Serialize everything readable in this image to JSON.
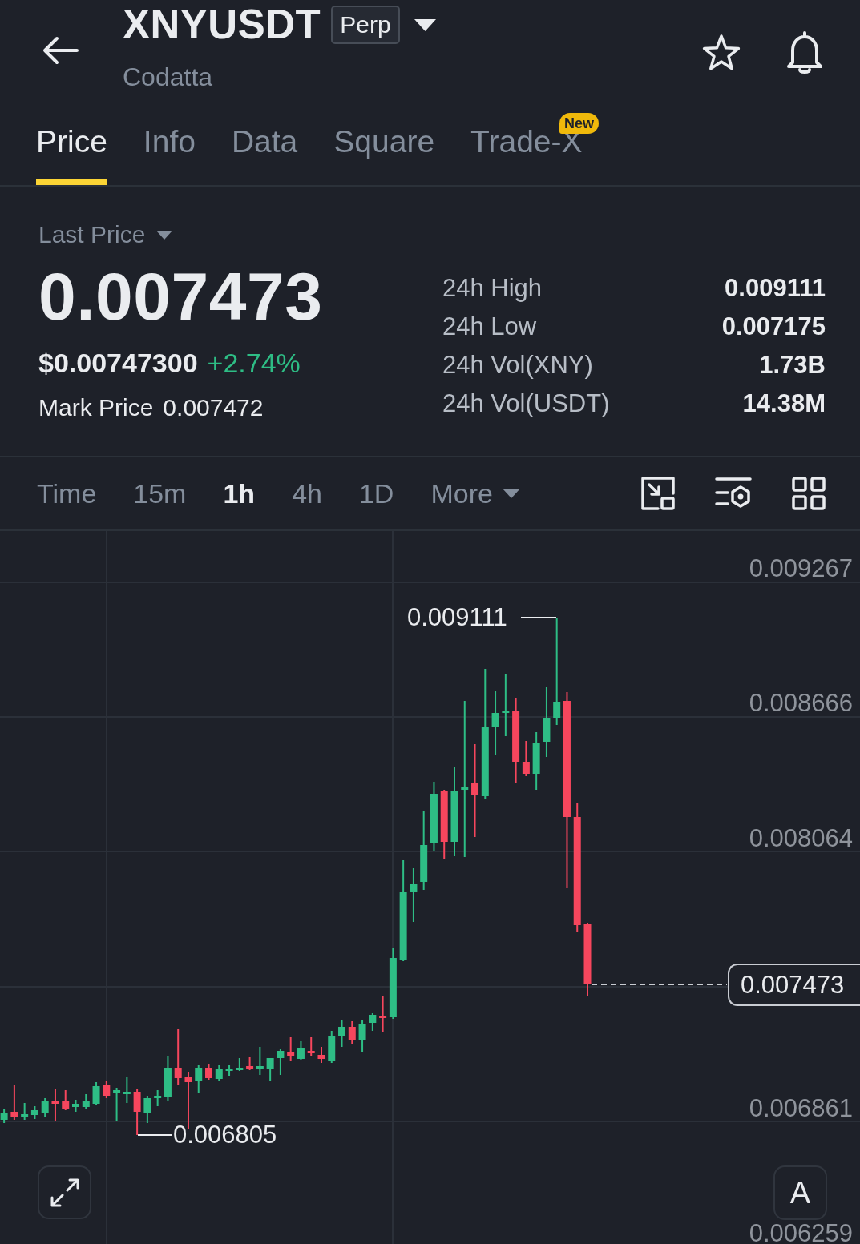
{
  "header": {
    "symbol": "XNYUSDT",
    "contract_type": "Perp",
    "name": "Codatta"
  },
  "tabs": [
    {
      "label": "Price",
      "selected": true
    },
    {
      "label": "Info",
      "selected": false
    },
    {
      "label": "Data",
      "selected": false
    },
    {
      "label": "Square",
      "selected": false
    },
    {
      "label": "Trade-X",
      "selected": false,
      "badge": "New"
    }
  ],
  "price": {
    "selector": "Last Price",
    "value": "0.007473",
    "usd_value": "$0.00747300",
    "change": "+2.74%",
    "mark_price_label": "Mark Price",
    "mark_price": "0.007472"
  },
  "stats": [
    {
      "label": "24h High",
      "value": "0.009111"
    },
    {
      "label": "24h Low",
      "value": "0.007175"
    },
    {
      "label": "24h Vol(XNY)",
      "value": "1.73B"
    },
    {
      "label": "24h Vol(USDT)",
      "value": "14.38M"
    }
  ],
  "intervals": [
    {
      "label": "Time",
      "selected": false
    },
    {
      "label": "15m",
      "selected": false
    },
    {
      "label": "1h",
      "selected": true
    },
    {
      "label": "4h",
      "selected": false
    },
    {
      "label": "1D",
      "selected": false
    }
  ],
  "more_menu": {
    "label": "More"
  },
  "chart": {
    "price_axis": [
      "0.009267",
      "0.008666",
      "0.008064",
      "0.006861",
      "0.006259"
    ],
    "high_label": "0.009111",
    "low_label": "0.006805",
    "current_price": "0.007473",
    "scale_mode": "A"
  }
}
